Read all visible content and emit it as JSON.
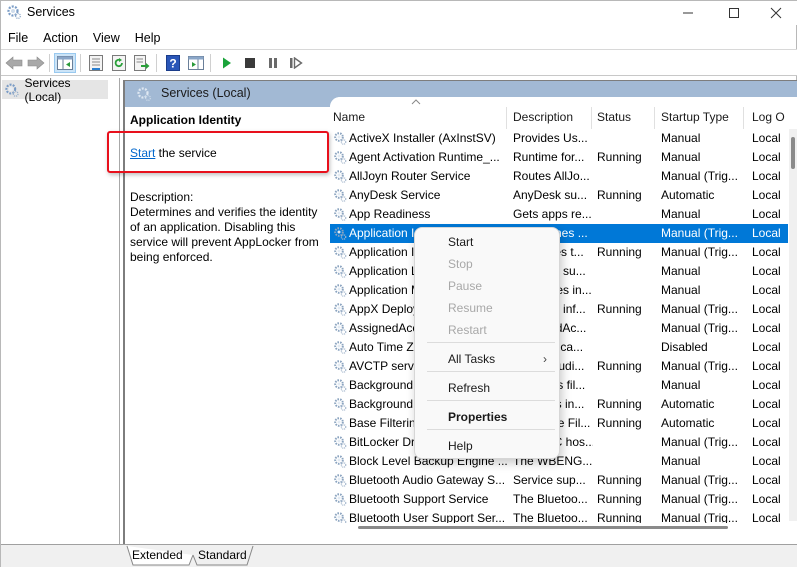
{
  "window": {
    "title": "Services",
    "minimize_glyph": "—",
    "maximize_glyph": "☐",
    "close_glyph": "✕"
  },
  "menubar": {
    "items": [
      "File",
      "Action",
      "View",
      "Help"
    ]
  },
  "toolbar": {
    "buttons": [
      {
        "icon": "back-arrow-icon"
      },
      {
        "icon": "forward-arrow-icon"
      },
      {
        "icon": "show-hide-console-tree-icon"
      },
      {
        "icon": "properties-icon"
      },
      {
        "icon": "refresh-icon"
      },
      {
        "icon": "export-list-icon"
      },
      {
        "icon": "help-icon",
        "glyph": "?"
      },
      {
        "icon": "show-action-pane-icon"
      },
      {
        "icon": "start-service-icon"
      },
      {
        "icon": "stop-service-icon"
      },
      {
        "icon": "pause-service-icon"
      },
      {
        "icon": "resume-service-icon"
      }
    ]
  },
  "tree": {
    "items": [
      {
        "label": "Services (Local)",
        "icon": "services-gear-icon"
      }
    ]
  },
  "content_header": {
    "title": "Services (Local)"
  },
  "detail": {
    "service_name": "Application Identity",
    "start_link": "Start",
    "start_suffix": " the service",
    "description_label": "Description:",
    "description_text": "Determines and verifies the identity of an application. Disabling this service will prevent AppLocker from being enforced."
  },
  "list": {
    "columns": [
      "Name",
      "Description",
      "Status",
      "Startup Type",
      "Log O"
    ],
    "sort_indicator": "^",
    "rows": [
      {
        "name": "ActiveX Installer (AxInstSV)",
        "desc": "Provides Us...",
        "status": "",
        "startup": "Manual",
        "log": "Local"
      },
      {
        "name": "Agent Activation Runtime_...",
        "desc": "Runtime for...",
        "status": "Running",
        "startup": "Manual",
        "log": "Local"
      },
      {
        "name": "AllJoyn Router Service",
        "desc": "Routes AllJo...",
        "status": "",
        "startup": "Manual (Trig...",
        "log": "Local"
      },
      {
        "name": "AnyDesk Service",
        "desc": "AnyDesk su...",
        "status": "Running",
        "startup": "Automatic",
        "log": "Local"
      },
      {
        "name": "App Readiness",
        "desc": "Gets apps re...",
        "status": "",
        "startup": "Manual",
        "log": "Local"
      },
      {
        "name": "Application Identity",
        "desc": "Determines ...",
        "status": "",
        "startup": "Manual (Trig...",
        "log": "Local",
        "selected": true
      },
      {
        "name": "Application Information",
        "desc": "Facilitates t...",
        "status": "Running",
        "startup": "Manual (Trig...",
        "log": "Local"
      },
      {
        "name": "Application Layer Gateway...",
        "desc": "Provides su...",
        "status": "",
        "startup": "Manual",
        "log": "Local"
      },
      {
        "name": "Application Management",
        "desc": "Processes in...",
        "status": "",
        "startup": "Manual",
        "log": "Local"
      },
      {
        "name": "AppX Deployment Service (...",
        "desc": "Provides inf...",
        "status": "Running",
        "startup": "Manual (Trig...",
        "log": "Local"
      },
      {
        "name": "AssignedAccessManager Se...",
        "desc": "AssignedAc...",
        "status": "",
        "startup": "Manual (Trig...",
        "log": "Local"
      },
      {
        "name": "Auto Time Zone Updater",
        "desc": "Automatica...",
        "status": "",
        "startup": "Disabled",
        "log": "Local"
      },
      {
        "name": "AVCTP service",
        "desc": "This is Audi...",
        "status": "Running",
        "startup": "Manual (Trig...",
        "log": "Local"
      },
      {
        "name": "Background Intelligent Tra...",
        "desc": "Transfers fil...",
        "status": "",
        "startup": "Manual",
        "log": "Local"
      },
      {
        "name": "Background Tasks Infrastru...",
        "desc": "Windows in...",
        "status": "Running",
        "startup": "Automatic",
        "log": "Local"
      },
      {
        "name": "Base Filtering Engine",
        "desc": "The Base Fil...",
        "status": "Running",
        "startup": "Automatic",
        "log": "Local"
      },
      {
        "name": "BitLocker Drive Encryption ...",
        "desc": "BDESVC hos...",
        "status": "",
        "startup": "Manual (Trig...",
        "log": "Local"
      },
      {
        "name": "Block Level Backup Engine ...",
        "desc": "The WBENG...",
        "status": "",
        "startup": "Manual",
        "log": "Local"
      },
      {
        "name": "Bluetooth Audio Gateway S...",
        "desc": "Service sup...",
        "status": "Running",
        "startup": "Manual (Trig...",
        "log": "Local"
      },
      {
        "name": "Bluetooth Support Service",
        "desc": "The Bluetoo...",
        "status": "Running",
        "startup": "Manual (Trig...",
        "log": "Local"
      },
      {
        "name": "Bluetooth User Support Ser...",
        "desc": "The Bluetoo...",
        "status": "Running",
        "startup": "Manual (Trig...",
        "log": "Local"
      }
    ]
  },
  "context_menu": {
    "items": [
      {
        "label": "Start",
        "state": "enabled"
      },
      {
        "label": "Stop",
        "state": "disabled"
      },
      {
        "label": "Pause",
        "state": "disabled"
      },
      {
        "label": "Resume",
        "state": "disabled"
      },
      {
        "label": "Restart",
        "state": "disabled"
      },
      {
        "label": "All Tasks",
        "state": "enabled",
        "submenu": true,
        "arrow": "›"
      },
      {
        "label": "Refresh",
        "state": "enabled"
      },
      {
        "label": "Properties",
        "state": "enabled",
        "bold": true
      },
      {
        "label": "Help",
        "state": "enabled"
      }
    ]
  },
  "bottom_tabs": {
    "tabs": [
      {
        "label": "Extended",
        "active": true
      },
      {
        "label": "Standard",
        "active": false
      }
    ]
  },
  "colors": {
    "selection": "#0078d7",
    "header_band": "#a2b9d4",
    "link": "#0066cc",
    "highlight_box": "#e8101c",
    "play_green": "#1aa33a"
  }
}
